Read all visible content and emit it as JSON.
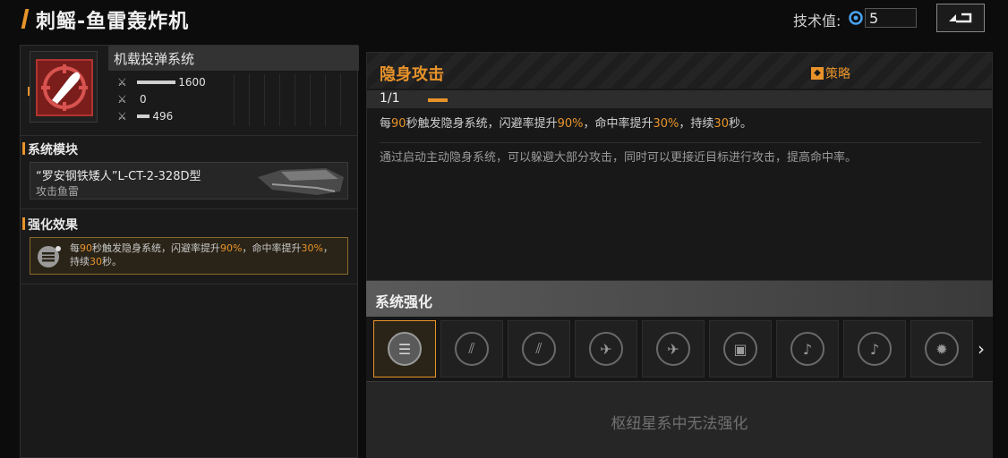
{
  "header": {
    "title": "刺鳐-鱼雷轰炸机",
    "tech_label": "技术值:",
    "tech_value": "5",
    "tech_icon": "tech-gem-icon",
    "back_icon": "back-arrow-icon"
  },
  "left": {
    "system_title": "机载投弹系统",
    "stats": [
      {
        "icon": "damage-icon",
        "value": "1600",
        "fill": 0.9
      },
      {
        "icon": "penetration-icon",
        "value": "0",
        "fill": 0
      },
      {
        "icon": "range-icon",
        "value": "496",
        "fill": 0.3
      }
    ],
    "module_section": "系统模块",
    "module_name": "“罗安钢铁矮人”L-CT-2-328D型",
    "module_type": "攻击鱼雷",
    "effect_section": "强化效果",
    "effect_text_parts": [
      "每",
      "90",
      "秒触发隐身系统，闪避率提升",
      "90%",
      "，命中率提升",
      "30%",
      "，",
      "持续",
      "30",
      "秒。"
    ]
  },
  "right": {
    "skill_title": "隐身攻击",
    "strategy_icon": "strategy-icon",
    "strategy_label": "策略",
    "level": "1/1",
    "desc_parts": [
      "每",
      "90",
      "秒触发隐身系统，闪避率提升",
      "90%",
      "，命中率提升",
      "30%",
      "，持续",
      "30",
      "秒。"
    ],
    "lore": "通过启动主动隐身系统，可以躲避大部分攻击，同时可以更接近目标进行攻击，提高命中率。"
  },
  "enhance": {
    "title": "系统强化",
    "slots": [
      {
        "icon": "stealth-icon",
        "selected": true
      },
      {
        "icon": "missile-volley-icon",
        "selected": false
      },
      {
        "icon": "missile-volley-icon",
        "selected": false
      },
      {
        "icon": "plane-icon",
        "selected": false
      },
      {
        "icon": "plane-icon",
        "selected": false
      },
      {
        "icon": "chip-icon",
        "selected": false
      },
      {
        "icon": "guitar-icon",
        "selected": false
      },
      {
        "icon": "guitar-icon",
        "selected": false
      },
      {
        "icon": "burst-icon",
        "selected": false
      }
    ],
    "next_icon": "chevron-right-icon",
    "unavailable_text": "枢纽星系中无法强化"
  },
  "colors": {
    "accent": "#e8932a",
    "icon_red": "#7a1d1b"
  }
}
